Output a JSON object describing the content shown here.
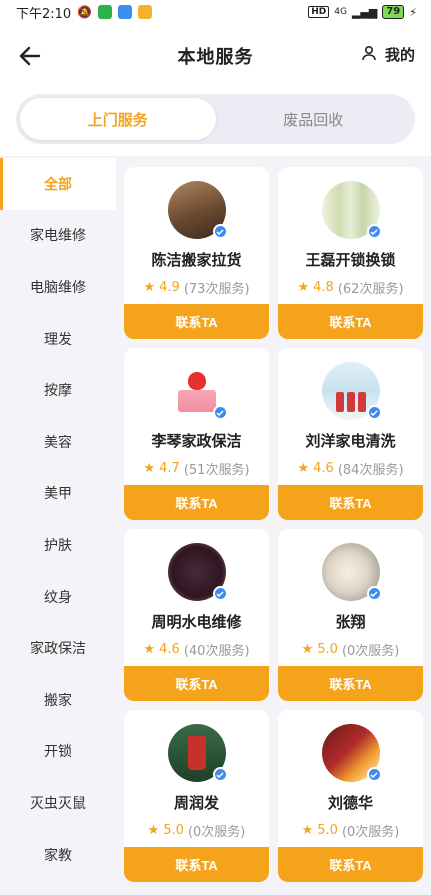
{
  "status": {
    "time": "下午2:10",
    "network": "4G",
    "battery": "79"
  },
  "header": {
    "title": "本地服务",
    "mine_label": "我的"
  },
  "tabs": [
    {
      "label": "上门服务",
      "active": true
    },
    {
      "label": "废品回收",
      "active": false
    }
  ],
  "sidebar": {
    "items": [
      {
        "label": "全部",
        "active": true
      },
      {
        "label": "家电维修"
      },
      {
        "label": "电脑维修"
      },
      {
        "label": "理发"
      },
      {
        "label": "按摩"
      },
      {
        "label": "美容"
      },
      {
        "label": "美甲"
      },
      {
        "label": "护肤"
      },
      {
        "label": "纹身"
      },
      {
        "label": "家政保洁"
      },
      {
        "label": "搬家"
      },
      {
        "label": "开锁"
      },
      {
        "label": "灭虫灭鼠"
      },
      {
        "label": "家教"
      }
    ]
  },
  "cards": [
    {
      "name": "陈洁搬家拉货",
      "score": "4.9",
      "count": "(73次服务)",
      "button": "联系TA",
      "avatar_color": "#8a6a4a",
      "avatar_icon": "storefront-photo"
    },
    {
      "name": "王磊开锁换锁",
      "score": "4.8",
      "count": "(62次服务)",
      "button": "联系TA",
      "avatar_color": "#d9e6c8",
      "avatar_icon": "bottles-photo"
    },
    {
      "name": "李琴家政保洁",
      "score": "4.7",
      "count": "(51次服务)",
      "button": "联系TA",
      "avatar_color": "#ffffff",
      "avatar_icon": "cake-photo"
    },
    {
      "name": "刘洋家电清洗",
      "score": "4.6",
      "count": "(84次服务)",
      "button": "联系TA",
      "avatar_color": "#cfe6f0",
      "avatar_icon": "water-bottles-photo"
    },
    {
      "name": "周明水电维修",
      "score": "4.6",
      "count": "(40次服务)",
      "button": "联系TA",
      "avatar_color": "#3a2230",
      "avatar_icon": "bowl-photo"
    },
    {
      "name": "张翔",
      "score": "5.0",
      "count": "(0次服务)",
      "button": "联系TA",
      "avatar_color": "#d8d0c8",
      "avatar_icon": "dessert-photo"
    },
    {
      "name": "周润发",
      "score": "5.0",
      "count": "(0次服务)",
      "button": "联系TA",
      "avatar_color": "#2a5a3a",
      "avatar_icon": "cup-photo"
    },
    {
      "name": "刘德华",
      "score": "5.0",
      "count": "(0次服务)",
      "button": "联系TA",
      "avatar_color": "#5a1a1a",
      "avatar_icon": "snack-photo"
    }
  ],
  "colors": {
    "accent": "#f5a31a",
    "verified": "#3b8ef0"
  }
}
